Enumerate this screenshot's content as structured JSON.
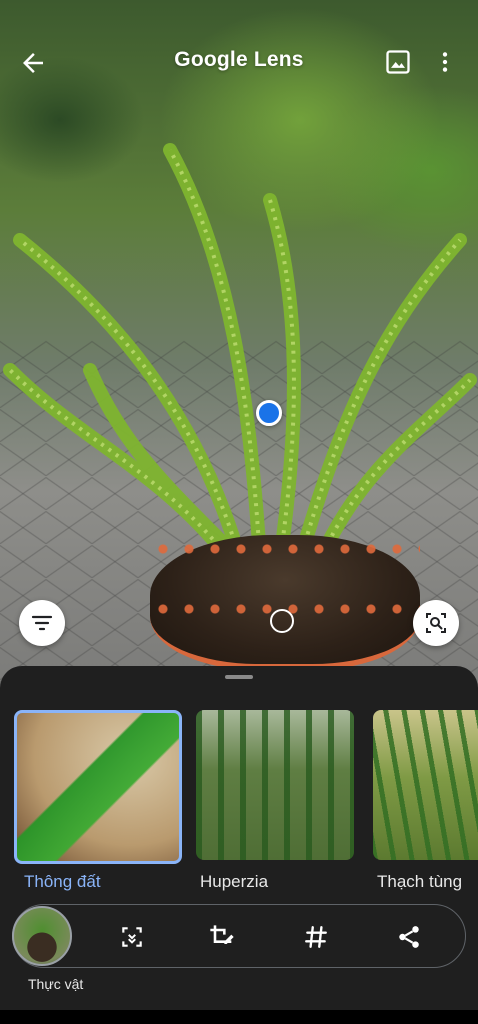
{
  "app": {
    "title": "Google Lens"
  },
  "topbar": {
    "back_icon": "arrow-back-icon",
    "gallery_icon": "image-gallery-icon",
    "more_icon": "more-vert-icon"
  },
  "lens": {
    "filter_icon": "filter-icon",
    "search_region_icon": "image-search-icon"
  },
  "results": [
    {
      "label": "Thông đất",
      "selected": true
    },
    {
      "label": "Huperzia",
      "selected": false
    },
    {
      "label": "Thạch tùng",
      "selected": false
    }
  ],
  "action_bar": {
    "avatar_caption": "Thực vật",
    "icons": [
      "translate-scan-icon",
      "crop-edit-icon",
      "hashtag-icon",
      "share-icon"
    ]
  },
  "colors": {
    "accent_blue": "#1a73e8",
    "selected_label": "#8ab4f8",
    "sheet_bg": "#1f1f1f"
  }
}
